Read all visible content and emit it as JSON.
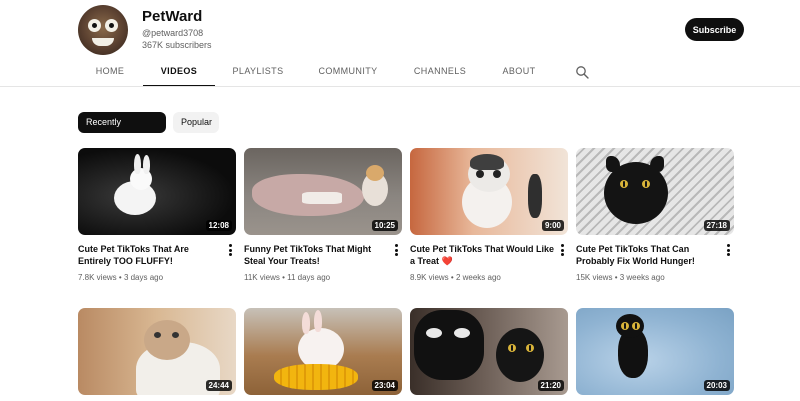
{
  "channel": {
    "name": "PetWard",
    "handle": "@petward3708",
    "subscribers": "367K subscribers",
    "subscribe_label": "Subscribe"
  },
  "tabs": [
    {
      "label": "HOME",
      "active": false
    },
    {
      "label": "VIDEOS",
      "active": true
    },
    {
      "label": "PLAYLISTS",
      "active": false
    },
    {
      "label": "COMMUNITY",
      "active": false
    },
    {
      "label": "CHANNELS",
      "active": false
    },
    {
      "label": "ABOUT",
      "active": false
    }
  ],
  "chips": [
    {
      "label": "Recently uploaded",
      "selected": true
    },
    {
      "label": "Popular",
      "selected": false
    }
  ],
  "videos": [
    {
      "title": "Cute Pet TikToks That Are Entirely TOO FLUFFY!",
      "duration": "12:08",
      "views": "7.8K views",
      "age": "3 days ago"
    },
    {
      "title": "Funny Pet TikToks That Might Steal Your Treats!",
      "duration": "10:25",
      "views": "11K views",
      "age": "11 days ago"
    },
    {
      "title": "Cute Pet TikToks That Would Like a Treat ❤️",
      "duration": "9:00",
      "views": "8.9K views",
      "age": "2 weeks ago"
    },
    {
      "title": "Cute Pet TikToks That Can Probably Fix World Hunger!",
      "duration": "27:18",
      "views": "15K views",
      "age": "3 weeks ago"
    },
    {
      "title": "",
      "duration": "24:44",
      "views": "",
      "age": ""
    },
    {
      "title": "",
      "duration": "23:04",
      "views": "",
      "age": ""
    },
    {
      "title": "",
      "duration": "21:20",
      "views": "",
      "age": ""
    },
    {
      "title": "",
      "duration": "20:03",
      "views": "",
      "age": ""
    }
  ],
  "colors": {
    "text_primary": "#0f0f0f",
    "text_secondary": "#606060",
    "chip_selected_bg": "#0f0f0f",
    "chip_bg": "#f2f2f2"
  }
}
